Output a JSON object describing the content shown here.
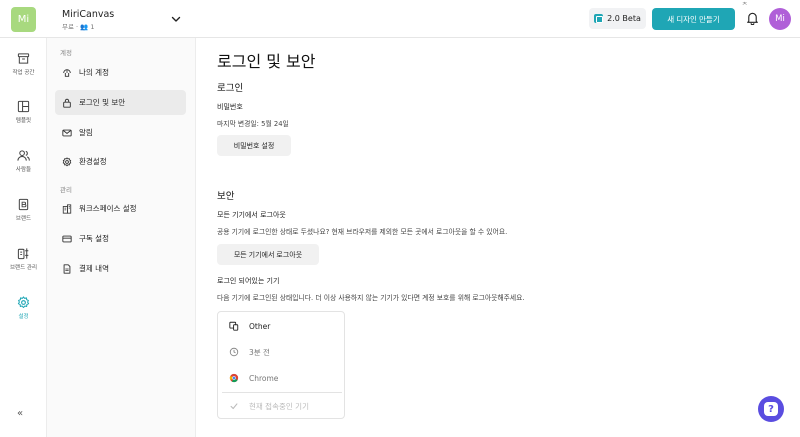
{
  "colors": {
    "accent": "#1fa6b5",
    "workspace_avatar": "#a8d97f",
    "user_avatar": "#b05fd8",
    "help": "#5a4de0"
  },
  "header": {
    "workspace_initials": "Mi",
    "workspace_name": "MiriCanvas",
    "workspace_sub": "무료 · 👥 1",
    "beta_label": "2.0 Beta",
    "new_design_label": "새 디자인 만들기",
    "user_initials": "Mi"
  },
  "rail": {
    "items": [
      {
        "label": "작업 공간",
        "icon": "archive-icon"
      },
      {
        "label": "템플릿",
        "icon": "layout-icon"
      },
      {
        "label": "사람들",
        "icon": "people-icon"
      },
      {
        "label": "브랜드",
        "icon": "brand-icon"
      },
      {
        "label": "브랜드 관리",
        "icon": "brand-manage-icon"
      },
      {
        "label": "설정",
        "icon": "gear-icon"
      }
    ],
    "collapse_symbol": "«"
  },
  "settings_nav": {
    "group_personal": "계정",
    "group_admin": "관리",
    "items": [
      {
        "label": "나의 계정",
        "icon": "account-icon"
      },
      {
        "label": "로그인 및 보안",
        "icon": "lock-icon"
      },
      {
        "label": "알림",
        "icon": "mail-icon"
      },
      {
        "label": "환경설정",
        "icon": "gear-icon"
      },
      {
        "label": "워크스페이스 설정",
        "icon": "workspace-icon"
      },
      {
        "label": "구독 설정",
        "icon": "card-icon"
      },
      {
        "label": "결제 내역",
        "icon": "receipt-icon"
      }
    ]
  },
  "main": {
    "title": "로그인 및 보안",
    "login_section": "로그인",
    "password_label": "비밀번호",
    "password_changed": "마지막 변경일: 5월 24일",
    "password_button": "비밀번호 설정",
    "security_section": "보안",
    "logout_all_label": "모든 기기에서 로그아웃",
    "logout_all_desc": "공용 기기에 로그인한 상태로 두셨나요? 현재 브라우저를 제외한 모든 곳에서 로그아웃을 할 수 있어요.",
    "logout_all_button": "모든 기기에서 로그아웃",
    "devices_label": "로그인 되어있는 기기",
    "devices_desc": "다음 기기에 로그인된 상태입니다. 더 이상 사용하지 않는 기기가 있다면 계정 보호를 위해 로그아웃해주세요.",
    "device": {
      "name": "Other",
      "time": "3분 전",
      "browser": "Chrome",
      "current": "현재 접속중인 기기"
    }
  },
  "help_label": "?",
  "top_mark": "ᄎ"
}
